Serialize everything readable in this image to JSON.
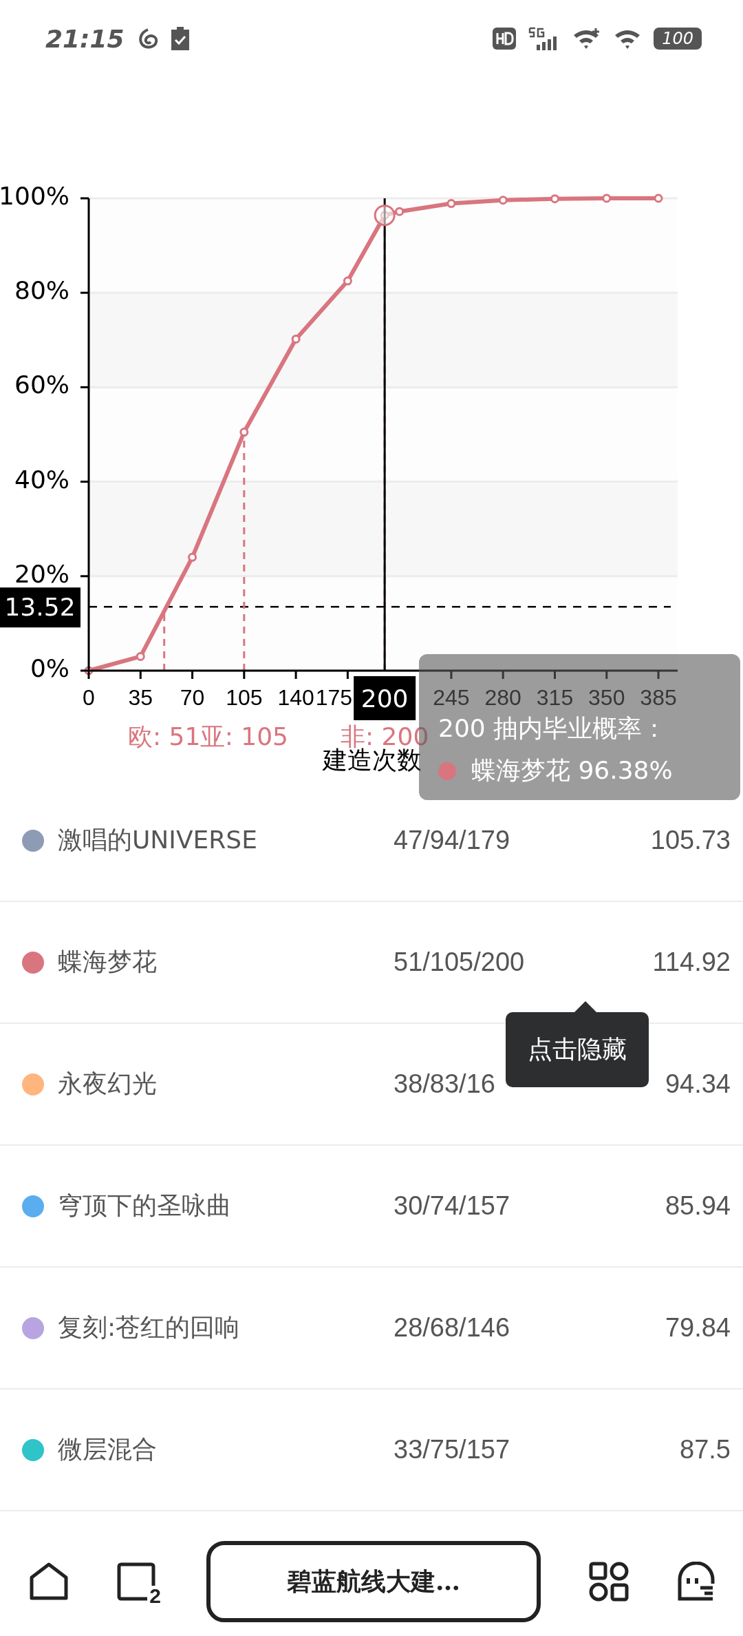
{
  "status_bar": {
    "time": "21:15",
    "battery": "100"
  },
  "chart": {
    "chart_data": {
      "type": "line",
      "xlabel": "建造次数",
      "x": [
        0,
        35,
        70,
        105,
        140,
        175,
        200,
        210,
        245,
        280,
        315,
        350,
        385
      ],
      "series": [
        {
          "name": "蝶海梦花",
          "color": "#d9757f",
          "marker": "circle",
          "values": [
            0,
            3,
            24,
            50.5,
            70.2,
            82.5,
            96.4,
            97.2,
            98.9,
            99.6,
            99.9,
            100,
            100
          ]
        }
      ],
      "xlim": [
        0,
        398
      ],
      "ylim": [
        0,
        100
      ],
      "grid": true,
      "xticks": [
        0,
        35,
        70,
        105,
        140,
        175,
        245,
        280,
        315,
        350,
        385
      ],
      "yticks": [
        {
          "value": 0,
          "label": "0%"
        },
        {
          "value": 20,
          "label": "20%"
        },
        {
          "value": 40,
          "label": "40%"
        },
        {
          "value": 60,
          "label": "60%"
        },
        {
          "value": 80,
          "label": "80%"
        },
        {
          "value": 100,
          "label": "100%"
        }
      ],
      "ref_lines": [
        {
          "axis": "y",
          "value": 13.52,
          "label": "13.52"
        },
        {
          "axis": "x",
          "value": 51,
          "label": "欧: 51"
        },
        {
          "axis": "x",
          "value": 105,
          "label": "亚: 105"
        },
        {
          "axis": "x",
          "value": 200,
          "label": "非: 200"
        },
        {
          "axis": "x",
          "value": 200,
          "label": "200",
          "color": "#000000"
        }
      ]
    },
    "tooltip": {
      "title": "200 抽内毕业概率：",
      "items": [
        {
          "value": "96.38%"
        }
      ]
    }
  },
  "legend": {
    "rows": [
      {
        "name": "激唱的UNIVERSE",
        "counts": "47/94/179",
        "average": "105.73",
        "color": "#8e9bb5"
      },
      {
        "name": "蝶海梦花",
        "counts": "51/105/200",
        "average": "114.92",
        "color": "#d9757f"
      },
      {
        "name": "永夜幻光",
        "counts": "38/83/16",
        "average": "94.34",
        "color": "#ffb57e"
      },
      {
        "name": "穹顶下的圣咏曲",
        "counts": "30/74/157",
        "average": "85.94",
        "color": "#5aaef0"
      },
      {
        "name": "复刻:苍红的回响",
        "counts": "28/68/146",
        "average": "79.84",
        "color": "#b8a4e0"
      },
      {
        "name": "微层混合",
        "counts": "33/75/157",
        "average": "87.5",
        "color": "#2ec4c8"
      }
    ],
    "hint": "点击隐藏"
  },
  "bottom_nav": {
    "tab_count": "2",
    "title": "碧蓝航线大建…"
  }
}
